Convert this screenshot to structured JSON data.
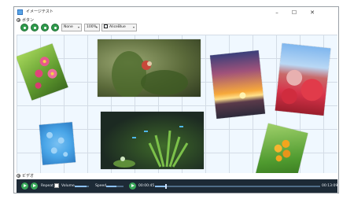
{
  "window": {
    "title": "イメージテスト"
  },
  "window_controls": {
    "minimize": "–",
    "maximize": "☐",
    "close": "✕"
  },
  "sections": {
    "top_label": "ボタン",
    "bottom_label": "ビデオ"
  },
  "toolbar": {
    "stretch": {
      "value": "None",
      "arrow": "▾"
    },
    "zoom": {
      "value": "100%",
      "arrow": "▾"
    },
    "background": {
      "value": "AliceBlue",
      "arrow": "▾",
      "color": "#f0f8ff"
    },
    "button_color": "#2f9c4c"
  },
  "canvas": {
    "background": "#f0f8ff",
    "grid_color": "#d3dce6"
  },
  "photos": [
    {
      "name": "pink-flowers-photo",
      "colors": [
        "#7fbf3c",
        "#e65a8c"
      ]
    },
    {
      "name": "bird-in-plants-photo",
      "colors": [
        "#6f7c4a",
        "#3f4a2a"
      ]
    },
    {
      "name": "sunset-photo",
      "colors": [
        "#f7a93b",
        "#6a3b5f"
      ]
    },
    {
      "name": "red-flowering-tree-photo",
      "colors": [
        "#e13b4a",
        "#8fc3f0"
      ]
    },
    {
      "name": "blue-hydrangea-photo",
      "colors": [
        "#4aa6e8",
        "#2d7cc4"
      ]
    },
    {
      "name": "aquarium-photo",
      "colors": [
        "#5fa13a",
        "#1c2a22"
      ]
    },
    {
      "name": "orange-flowers-photo",
      "colors": [
        "#f3a51d",
        "#4f9a2f"
      ]
    }
  ],
  "player": {
    "repeat_label": "Repeat",
    "repeat_checked": false,
    "volume_label": "Volume",
    "volume_level": 0.85,
    "speed_label": "Speed",
    "speed_level": 0.6,
    "current_time": "00:00:45",
    "total_time": "00:13:09",
    "progress": 0.06
  }
}
